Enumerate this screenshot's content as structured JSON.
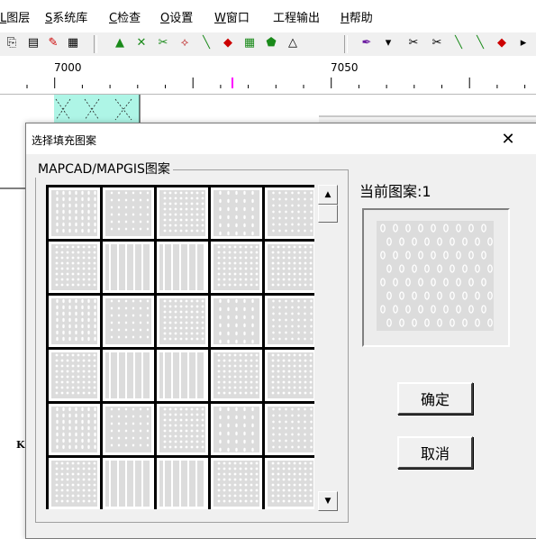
{
  "menu": [
    {
      "label": "L图层",
      "mnemonic": "L"
    },
    {
      "label": "S系统库",
      "mnemonic": "S"
    },
    {
      "label": "C检查",
      "mnemonic": "C"
    },
    {
      "label": "O设置",
      "mnemonic": "O"
    },
    {
      "label": "W窗口",
      "mnemonic": "W"
    },
    {
      "label": "工程输出",
      "mnemonic": ""
    },
    {
      "label": "H帮助",
      "mnemonic": "H"
    }
  ],
  "toolbar": {
    "icons": [
      "copy-icon",
      "paste-icon",
      "edit-icon",
      "properties-icon",
      "area-fill-icon",
      "area-transform-icon",
      "area-cut-icon",
      "area-link-icon",
      "area-line-icon",
      "area-color-icon",
      "area-grid-icon",
      "area-merge-icon",
      "area-select-icon",
      "line-pen-icon",
      "dropdown-arrow-icon",
      "line-cut-icon",
      "line-split-icon",
      "line-connect-icon",
      "line-node-icon",
      "line-color-icon",
      "line-more-icon"
    ]
  },
  "ruler": {
    "labels": [
      "7000",
      "7050"
    ],
    "marker_color": "#ff00ff"
  },
  "dialog": {
    "title": "选择填充图案",
    "close_symbol": "✕",
    "group_label": "MAPCAD/MAPGIS图案",
    "current_pattern_label": "当前图案:1",
    "ok_label": "确定",
    "cancel_label": "取消",
    "patterns": [
      1,
      2,
      3,
      4,
      5,
      6,
      7,
      8,
      9,
      10,
      11,
      12,
      13,
      14,
      15,
      16,
      17,
      18,
      19,
      20,
      21,
      22,
      23,
      24,
      25,
      26,
      27,
      28,
      29,
      30
    ],
    "selected_pattern": 1,
    "scroll_up_icon": "▲",
    "scroll_down_icon": "▼"
  },
  "colors": {
    "pattern_fill": "#dcdcdc",
    "pattern_mark": "#ffffff",
    "hatch_cell": "#aef5e6"
  }
}
